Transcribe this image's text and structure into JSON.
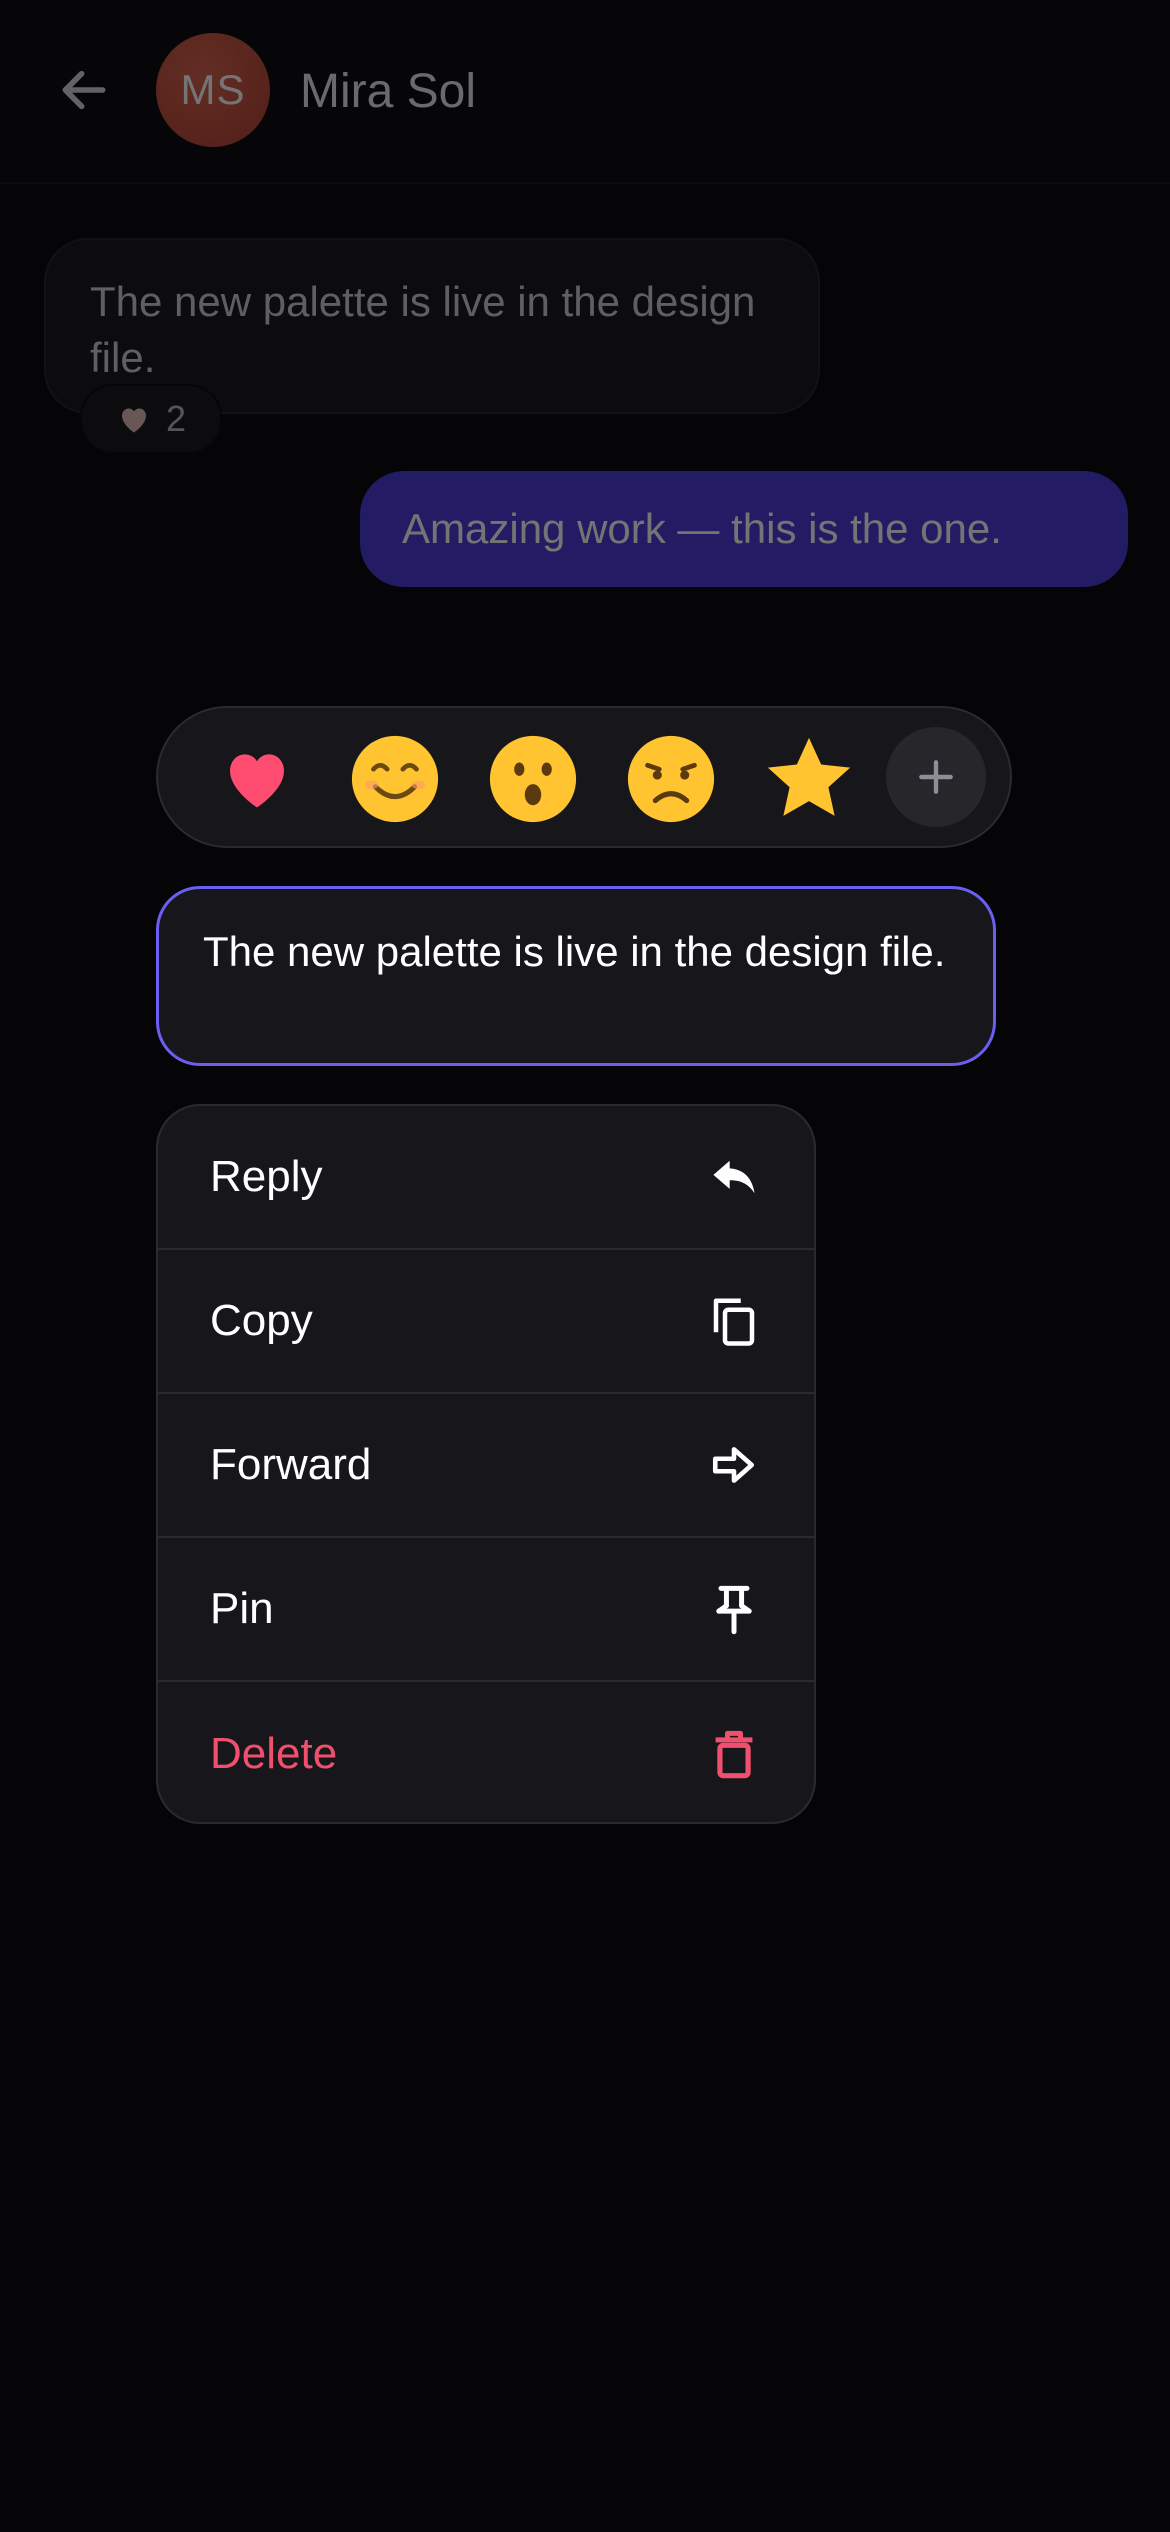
{
  "header": {
    "avatar_initials": "MS",
    "contact_name": "Mira Sol",
    "back_icon": "arrow-left-icon"
  },
  "messages": {
    "incoming": {
      "text": "The new palette is live in the design file.",
      "reaction": {
        "icon": "heart-icon",
        "count": "2"
      }
    },
    "outgoing": {
      "text": "Amazing work — this is the one."
    }
  },
  "reaction_picker": {
    "emojis": [
      "heart",
      "smiling-face",
      "surprised-face",
      "frowning-face",
      "star"
    ],
    "more_icon": "plus-icon"
  },
  "selected_message": {
    "text": "The new palette is live in the design file."
  },
  "context_menu": {
    "items": [
      {
        "label": "Reply",
        "icon": "reply-icon"
      },
      {
        "label": "Copy",
        "icon": "copy-icon"
      },
      {
        "label": "Forward",
        "icon": "forward-icon"
      },
      {
        "label": "Pin",
        "icon": "pin-icon"
      },
      {
        "label": "Delete",
        "icon": "trash-icon",
        "color": "#f0506e"
      }
    ]
  },
  "colors": {
    "accent": "#6c5ef0",
    "outgoing_bubble": "#4a38d9",
    "danger": "#f0506e",
    "heart": "#ff4d72",
    "emoji_yellow": "#ffc430"
  }
}
